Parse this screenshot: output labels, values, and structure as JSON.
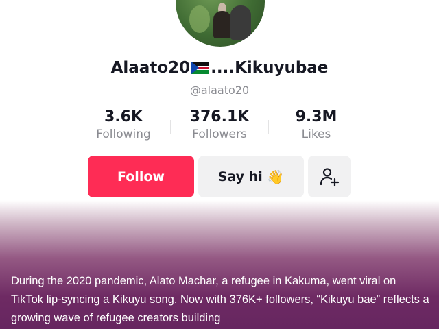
{
  "profile": {
    "name_prefix": "Alaato20",
    "name_suffix": "....Kikuyubae",
    "flag_icon": "south-sudan-flag-icon",
    "handle": "@alaato20"
  },
  "stats": {
    "following": {
      "value": "3.6K",
      "label": "Following"
    },
    "followers": {
      "value": "376.1K",
      "label": "Followers"
    },
    "likes": {
      "value": "9.3M",
      "label": "Likes"
    }
  },
  "actions": {
    "follow_label": "Follow",
    "say_hi_label": "Say hi",
    "say_hi_emoji": "👋",
    "add_friend_icon": "add-user-icon"
  },
  "caption": {
    "text": "During the 2020 pandemic, Alato Machar, a refugee in Kakuma, went viral on TikTok lip-syncing a Kikuyu song. Now with 376K+ followers, “Kikuyu bae” reflects a growing wave of refugee creators building"
  },
  "colors": {
    "follow_button": "#fe2c55",
    "secondary_button": "#f1f1f2",
    "primary_text": "#161823",
    "muted_text": "#8a8b91",
    "overlay": "#6e2a63"
  }
}
